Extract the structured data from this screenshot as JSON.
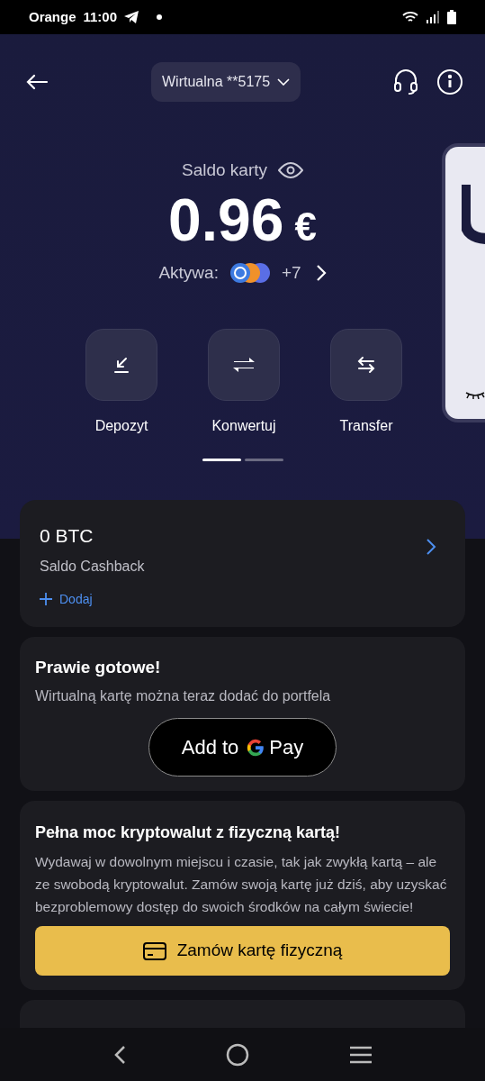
{
  "status_bar": {
    "carrier": "Orange",
    "time": "11:00"
  },
  "header": {
    "card_selector": "Wirtualna **5175"
  },
  "balance": {
    "label": "Saldo karty",
    "amount": "0.96",
    "currency": "€",
    "assets_label": "Aktywa:",
    "assets_more": "+7"
  },
  "actions": [
    {
      "kind": "deposit",
      "label": "Depozyt"
    },
    {
      "kind": "convert",
      "label": "Konwertuj"
    },
    {
      "kind": "transfer",
      "label": "Transfer"
    }
  ],
  "pager": [
    {
      "selected": true
    },
    {
      "selected": false
    }
  ],
  "cashback": {
    "amount": "0 BTC",
    "label": "Saldo Cashback",
    "add": "Dodaj"
  },
  "wallet_card": {
    "title": "Prawie gotowe!",
    "text": "Wirtualną kartę można teraz dodać do portfela",
    "button_prefix": "Add to",
    "button_suffix": "Pay"
  },
  "physical_card": {
    "title": "Pełna moc kryptowalut z fizyczną kartą!",
    "text": "Wydawaj w dowolnym miejscu i czasie, tak jak zwykłą kartą – ale ze swobodą kryptowalut. Zamów swoją kartę już dziś, aby uzyskać bezproblemowy dostęp do swoich środków na całym świecie!",
    "button": "Zamów kartę fizyczną"
  }
}
